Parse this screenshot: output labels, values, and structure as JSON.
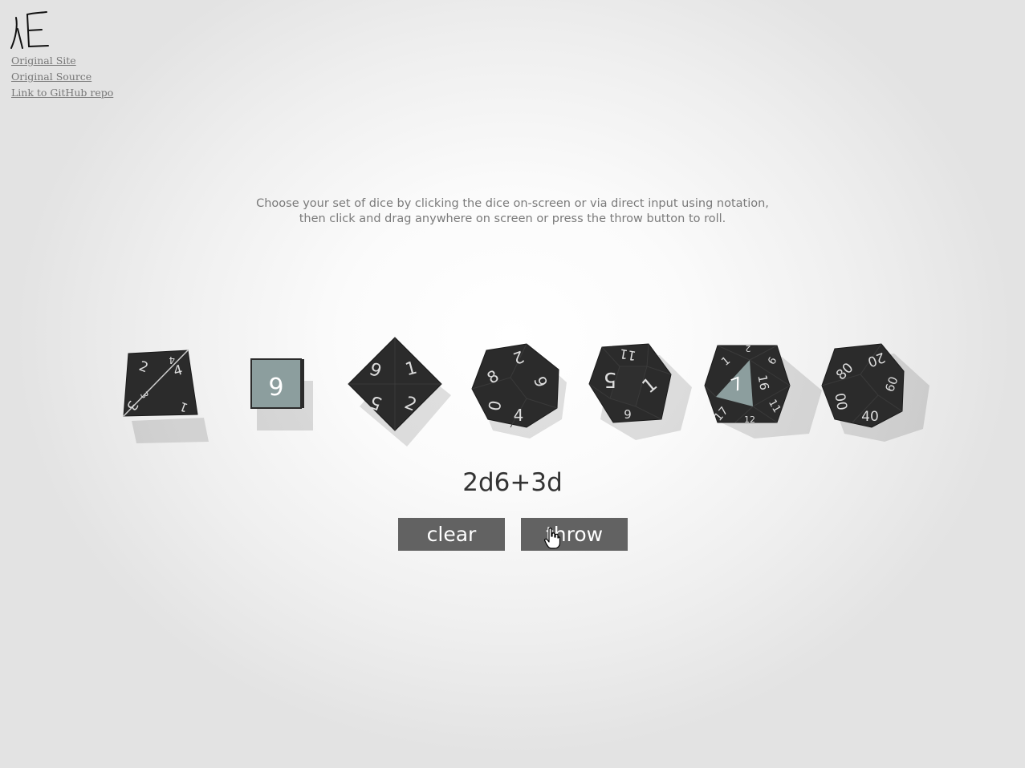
{
  "logo": {
    "icon": "logo-icon"
  },
  "links": [
    {
      "label": "Original Site"
    },
    {
      "label": "Original Source"
    },
    {
      "label": "Link to GitHub repo"
    }
  ],
  "instructions": {
    "line1": "Choose your set of dice by clicking the dice on-screen or via direct input using notation,",
    "line2": "then click and drag anywhere on screen or press the throw button to roll."
  },
  "dice": [
    {
      "type": "d4",
      "icon": "d4-die-icon",
      "faces": [
        "2",
        "4",
        "3",
        "1",
        "4",
        "3"
      ]
    },
    {
      "type": "d6",
      "icon": "d6-die-icon",
      "faces": [
        "6"
      ]
    },
    {
      "type": "d8",
      "icon": "d8-die-icon",
      "faces": [
        "6",
        "1",
        "5",
        "2"
      ]
    },
    {
      "type": "d10",
      "icon": "d10-die-icon",
      "faces": [
        "2",
        "8",
        "6",
        "0",
        "4"
      ]
    },
    {
      "type": "d12",
      "icon": "d12-die-icon",
      "faces": [
        "11",
        "5",
        "1",
        "6"
      ]
    },
    {
      "type": "d20",
      "icon": "d20-die-icon",
      "faces": [
        "7",
        "1",
        "2",
        "9",
        "16",
        "17",
        "11",
        "12"
      ]
    },
    {
      "type": "d100",
      "icon": "d100-die-icon",
      "faces": [
        "80",
        "20",
        "00",
        "60",
        "40"
      ]
    }
  ],
  "notation": "2d6+3d",
  "buttons": {
    "clear": "clear",
    "throw": "throw"
  },
  "cursor": {
    "icon": "hand-pointer-icon"
  },
  "colors": {
    "die_body": "#2b2b2b",
    "highlight_face": "#8c9e9e",
    "button_bg": "#626262",
    "link": "#777777"
  }
}
